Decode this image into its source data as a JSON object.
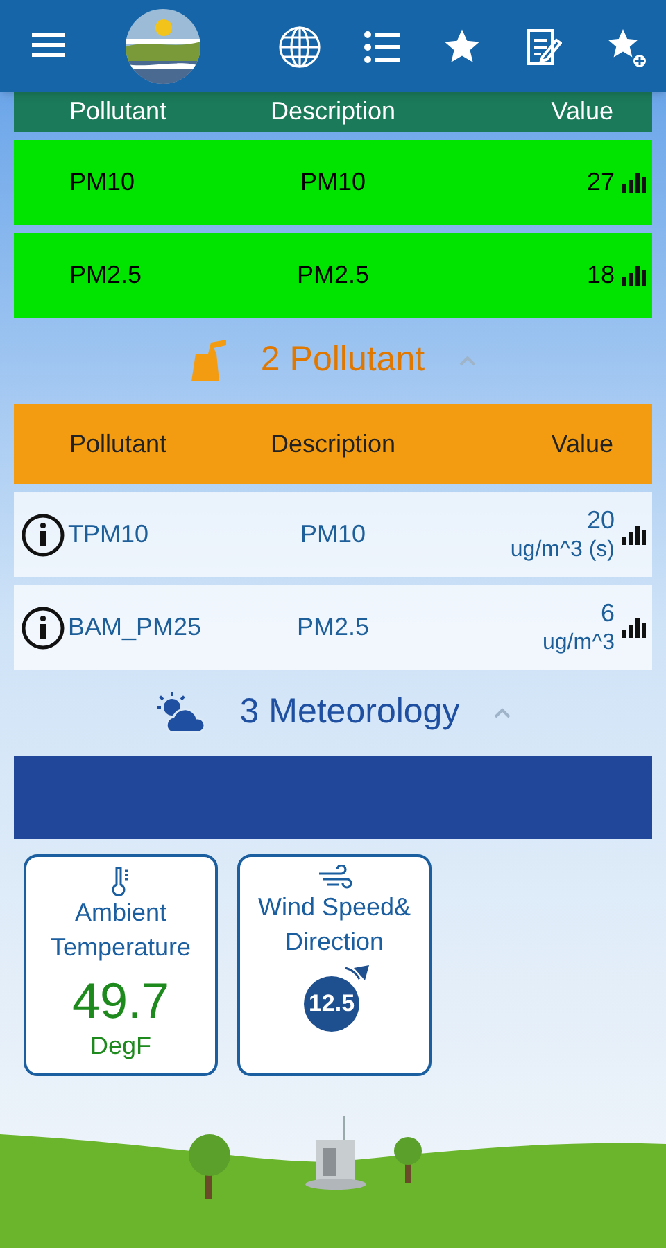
{
  "sections": [
    {
      "color": "#1b7a5a",
      "columns": [
        "Pollutant",
        "Description",
        "Value"
      ],
      "rows": [
        {
          "pollutant": "PM10",
          "description": "PM10",
          "value": "27",
          "color": "#00e400"
        },
        {
          "pollutant": "PM2.5",
          "description": "PM2.5",
          "value": "18",
          "color": "#00e400"
        }
      ]
    },
    {
      "title": "2 Pollutant",
      "kind": "pollutant",
      "expanded": true,
      "color": "#f39c12",
      "columns": [
        "Pollutant",
        "Description",
        "Value"
      ],
      "rows": [
        {
          "pollutant": "TPM10",
          "description": "PM10",
          "value": "20",
          "unit": "ug/m^3 (s)"
        },
        {
          "pollutant": "BAM_PM25",
          "description": "PM2.5",
          "value": "6",
          "unit": "ug/m^3"
        }
      ]
    },
    {
      "title": "3 Meteorology",
      "kind": "meteorology",
      "expanded": true,
      "color": "#21479b",
      "cards": [
        {
          "kind": "temperature",
          "title": "Ambient Temperature",
          "value": "49.7",
          "unit": "DegF"
        },
        {
          "kind": "wind",
          "title": "Wind Speed& Direction",
          "value": "12.5"
        }
      ]
    }
  ]
}
